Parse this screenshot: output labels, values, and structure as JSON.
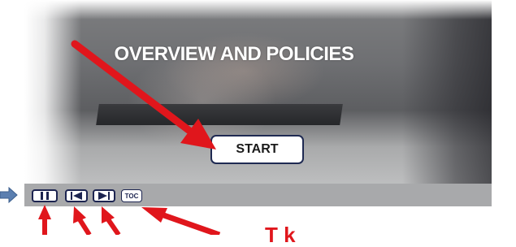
{
  "slide": {
    "title": "OVERVIEW AND POLICIES",
    "start_label": "START"
  },
  "player_controls": {
    "toc_label": "TOC",
    "pause_icon": "pause-icon",
    "prev_icon": "skip-back-icon",
    "next_icon": "skip-forward-icon"
  },
  "annotation": {
    "partial_text": "T k"
  },
  "colors": {
    "arrow": "#e0161c",
    "button_border": "#1f2a52",
    "control_bar": "#a8a9ab",
    "side_arrow": "#5b7fb0"
  }
}
